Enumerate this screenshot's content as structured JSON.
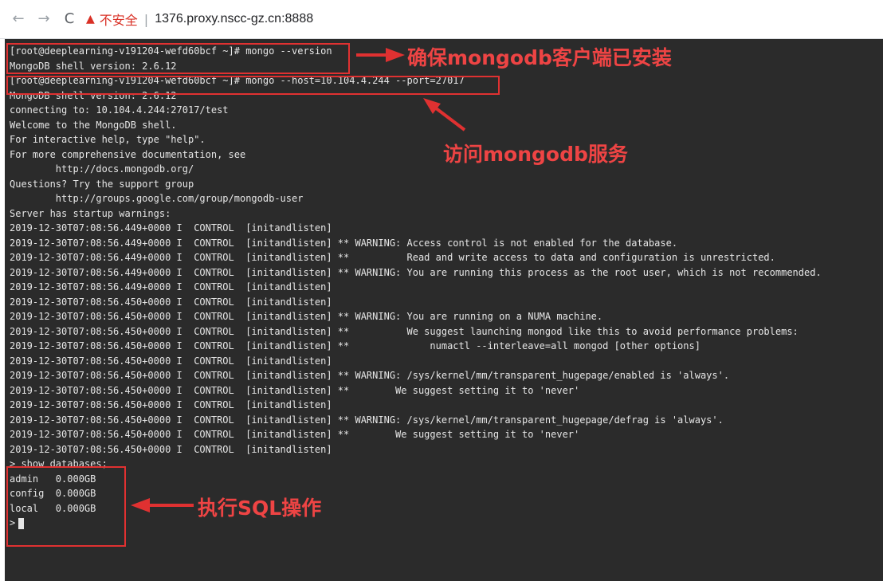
{
  "browser": {
    "back_icon": "←",
    "forward_icon": "→",
    "reload_icon": "C",
    "warning_icon": "▲",
    "security_label": "不安全",
    "separator": "|",
    "url": "1376.proxy.nscc-gz.cn:8888"
  },
  "terminal": {
    "lines": [
      "[root@deeplearning-v191204-wefd60bcf ~]# mongo --version",
      "MongoDB shell version: 2.6.12",
      "[root@deeplearning-v191204-wefd60bcf ~]# mongo --host=10.104.4.244 --port=27017",
      "MongoDB shell version: 2.6.12",
      "connecting to: 10.104.4.244:27017/test",
      "Welcome to the MongoDB shell.",
      "For interactive help, type \"help\".",
      "For more comprehensive documentation, see",
      "        http://docs.mongodb.org/",
      "Questions? Try the support group",
      "        http://groups.google.com/group/mongodb-user",
      "Server has startup warnings:",
      "2019-12-30T07:08:56.449+0000 I  CONTROL  [initandlisten]",
      "2019-12-30T07:08:56.449+0000 I  CONTROL  [initandlisten] ** WARNING: Access control is not enabled for the database.",
      "2019-12-30T07:08:56.449+0000 I  CONTROL  [initandlisten] **          Read and write access to data and configuration is unrestricted.",
      "2019-12-30T07:08:56.449+0000 I  CONTROL  [initandlisten] ** WARNING: You are running this process as the root user, which is not recommended.",
      "2019-12-30T07:08:56.449+0000 I  CONTROL  [initandlisten]",
      "2019-12-30T07:08:56.450+0000 I  CONTROL  [initandlisten]",
      "2019-12-30T07:08:56.450+0000 I  CONTROL  [initandlisten] ** WARNING: You are running on a NUMA machine.",
      "2019-12-30T07:08:56.450+0000 I  CONTROL  [initandlisten] **          We suggest launching mongod like this to avoid performance problems:",
      "2019-12-30T07:08:56.450+0000 I  CONTROL  [initandlisten] **              numactl --interleave=all mongod [other options]",
      "2019-12-30T07:08:56.450+0000 I  CONTROL  [initandlisten]",
      "2019-12-30T07:08:56.450+0000 I  CONTROL  [initandlisten] ** WARNING: /sys/kernel/mm/transparent_hugepage/enabled is 'always'.",
      "2019-12-30T07:08:56.450+0000 I  CONTROL  [initandlisten] **        We suggest setting it to 'never'",
      "2019-12-30T07:08:56.450+0000 I  CONTROL  [initandlisten]",
      "2019-12-30T07:08:56.450+0000 I  CONTROL  [initandlisten] ** WARNING: /sys/kernel/mm/transparent_hugepage/defrag is 'always'.",
      "2019-12-30T07:08:56.450+0000 I  CONTROL  [initandlisten] **        We suggest setting it to 'never'",
      "2019-12-30T07:08:56.450+0000 I  CONTROL  [initandlisten]",
      "> show databases;",
      "admin   0.000GB",
      "config  0.000GB",
      "local   0.000GB"
    ],
    "prompt": ">"
  },
  "annotations": {
    "label1": "确保mongodb客户端已安装",
    "label2": "访问mongodb服务",
    "label3": "执行SQL操作",
    "color": "#e03131"
  }
}
